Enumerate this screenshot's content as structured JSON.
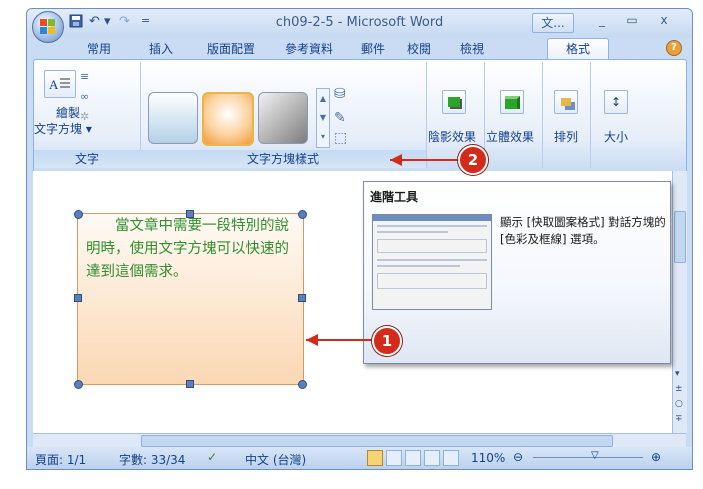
{
  "window": {
    "title": "ch09-2-5 - Microsoft Word",
    "min_label": "_",
    "max_label": "▭",
    "close_label": "x",
    "context_label": "文..."
  },
  "quick_access": {
    "save_icon": "save-icon",
    "undo_label": "↶ ▾",
    "redo_label": "↷",
    "customize_label": "="
  },
  "tabs": [
    {
      "label": "常用"
    },
    {
      "label": "插入"
    },
    {
      "label": "版面配置"
    },
    {
      "label": "參考資料"
    },
    {
      "label": "郵件"
    },
    {
      "label": "校閱"
    },
    {
      "label": "檢視"
    },
    {
      "label": "格式"
    }
  ],
  "ribbon": {
    "text_group": {
      "label": "文字",
      "draw_label": "繪製",
      "direction_label": "文字方塊 ▾"
    },
    "styles_group": {
      "label": "文字方塊樣式"
    },
    "shadow_group": {
      "label": "陰影效果"
    },
    "threed_group": {
      "label": "立體效果"
    },
    "arrange_group": {
      "label": "排列"
    },
    "size_group": {
      "label": "大小"
    }
  },
  "document": {
    "textbox_text": "　　當文章中需要一段特別的說明時，使用文字方塊可以快速的達到這個需求。"
  },
  "tooltip": {
    "title": "進階工具",
    "description": "顯示 [快取圖案格式] 對話方塊的 [色彩及框線] 選項。"
  },
  "callouts": {
    "one": "1",
    "two": "2"
  },
  "status_bar": {
    "page": "頁面: 1/1",
    "words": "字數: 33/34",
    "language": "中文 (台灣)",
    "zoom": "110%"
  },
  "colors": {
    "accent": "#d42a1c",
    "textbox_text": "#2e8f2e",
    "ribbon_text": "#15428b"
  }
}
